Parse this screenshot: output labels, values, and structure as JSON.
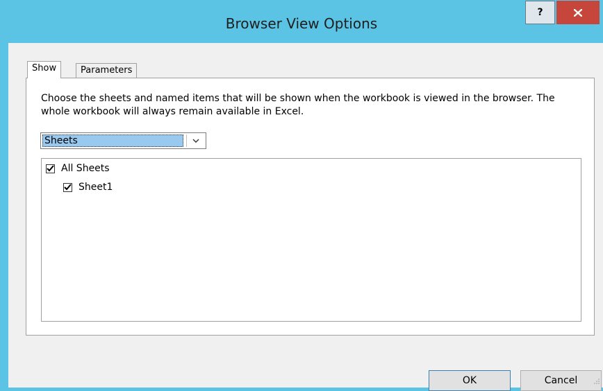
{
  "window": {
    "title": "Browser View Options",
    "help_label": "?",
    "close_icon": "close-icon"
  },
  "tabs": [
    {
      "label": "Show",
      "selected": true
    },
    {
      "label": "Parameters",
      "selected": false
    }
  ],
  "show_tab": {
    "description": "Choose the sheets and named items that will be shown when the workbook is viewed in the browser. The whole workbook will always remain available in Excel.",
    "dropdown": {
      "selected": "Sheets",
      "icon": "chevron-down-icon"
    },
    "items": [
      {
        "label": "All Sheets",
        "checked": true
      },
      {
        "label": "Sheet1",
        "checked": true
      }
    ]
  },
  "buttons": {
    "ok": "OK",
    "cancel": "Cancel"
  },
  "colors": {
    "title_bar": "#5bc4e5",
    "close_button": "#c7463b",
    "selection": "#99c9ef"
  }
}
